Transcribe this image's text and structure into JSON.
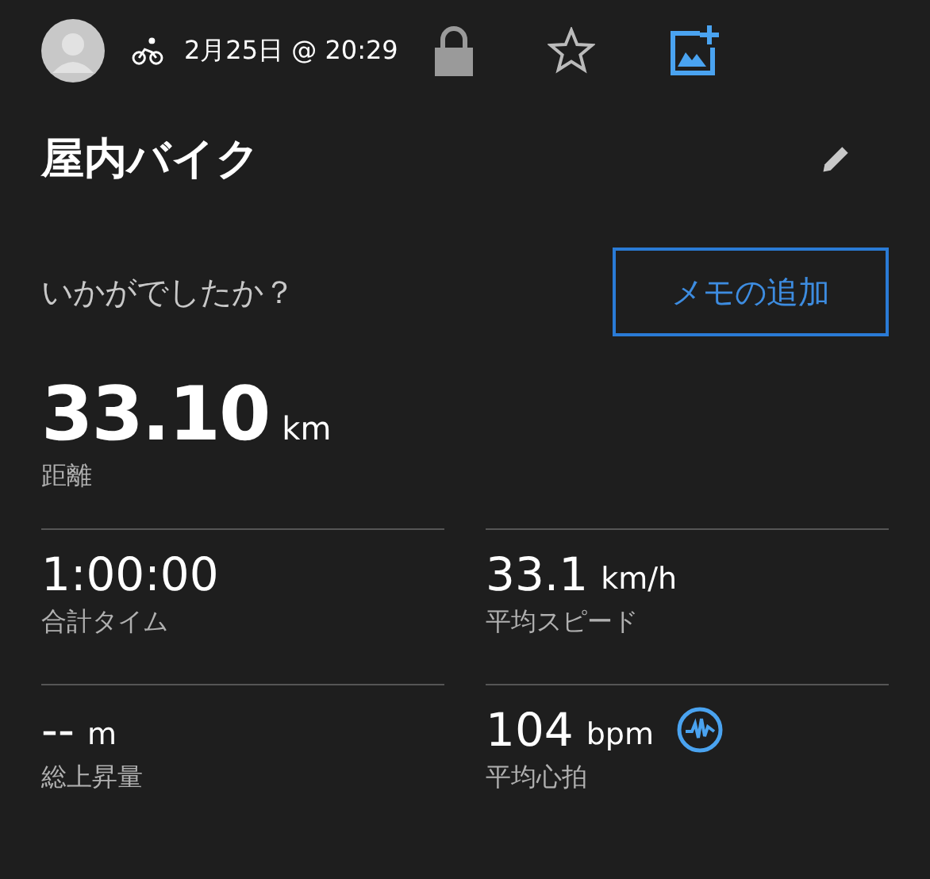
{
  "header": {
    "date": "2月25日 @ 20:29"
  },
  "activity": {
    "title": "屋内バイク"
  },
  "note": {
    "prompt": "いかがでしたか？",
    "button": "メモの追加"
  },
  "distance": {
    "value": "33.10",
    "unit": "km",
    "label": "距離"
  },
  "stats": [
    {
      "kind": "plain",
      "value": "1:00:00",
      "label": "合計タイム"
    },
    {
      "kind": "plain",
      "value": "33.1",
      "unit": "km/h",
      "label": "平均スピード"
    },
    {
      "kind": "plain",
      "value": "--",
      "unit": "m",
      "label": "総上昇量"
    },
    {
      "kind": "heart",
      "value": "104",
      "unit": "bpm",
      "label": "平均心拍"
    }
  ]
}
